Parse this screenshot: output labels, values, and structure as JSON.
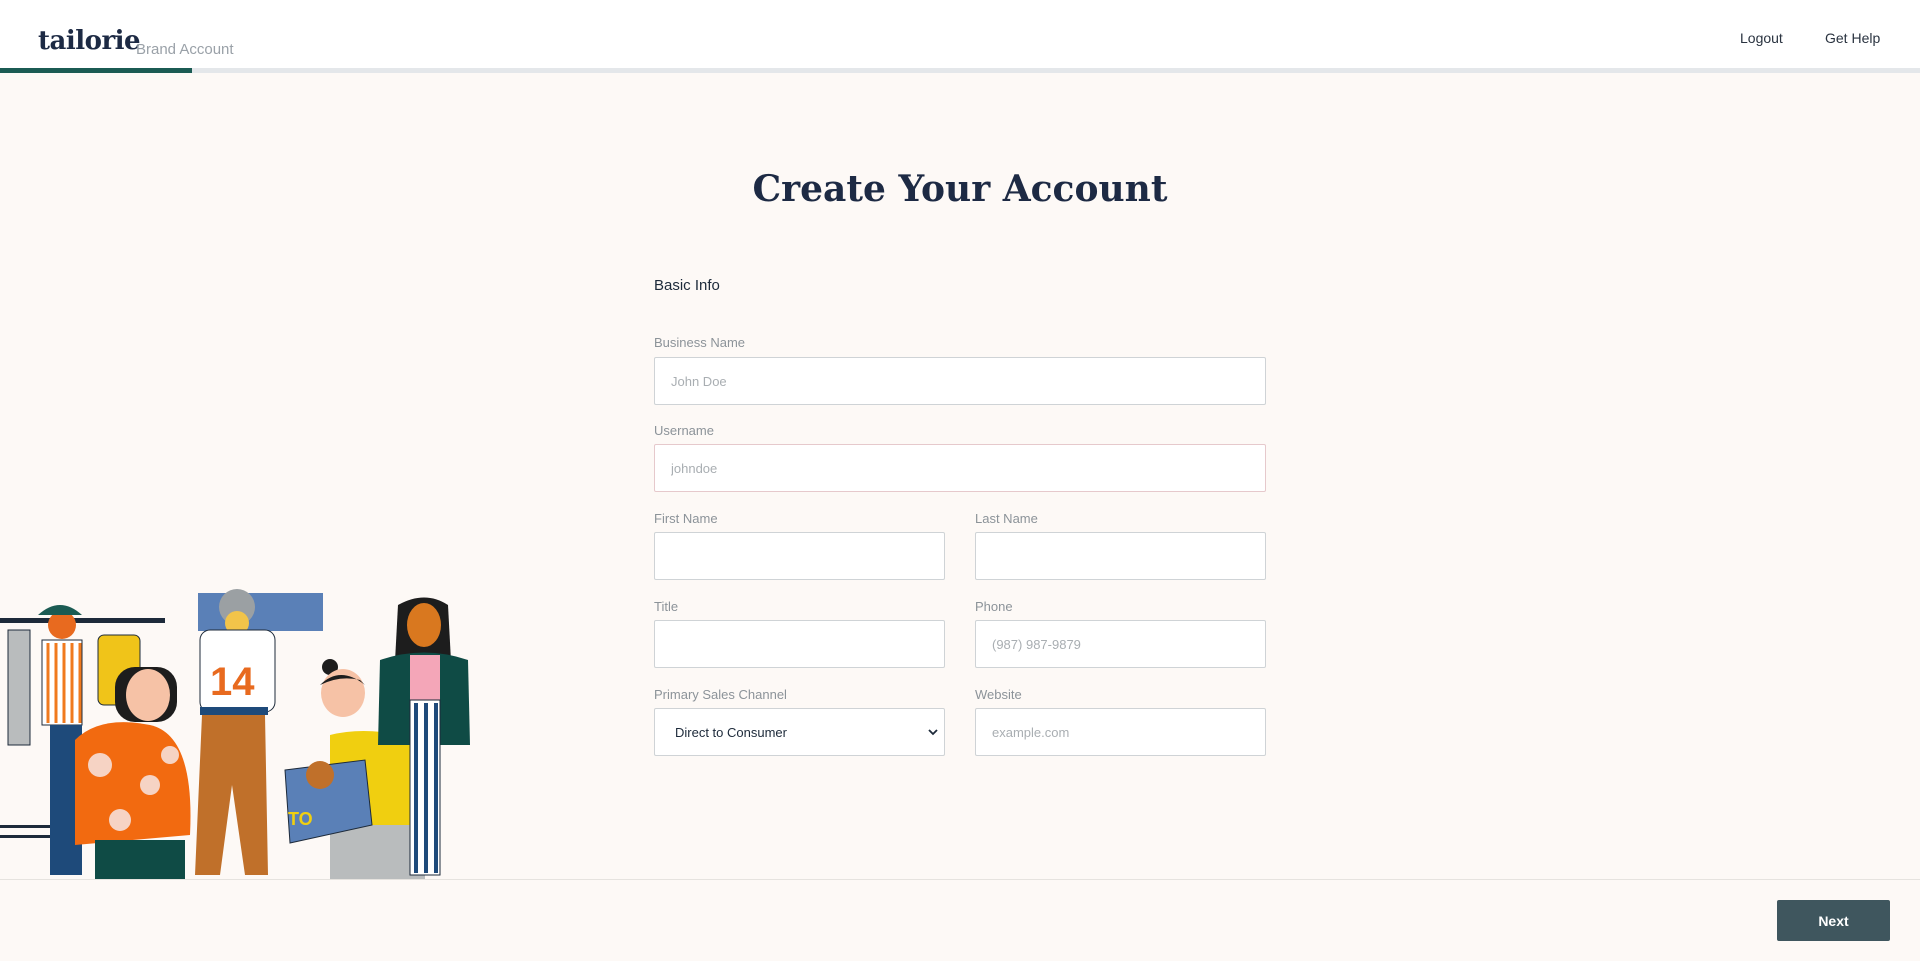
{
  "header": {
    "logo": "tailorie",
    "subtitle": "Brand Account",
    "links": {
      "logout": "Logout",
      "help": "Get Help"
    },
    "progress": 0.1
  },
  "main": {
    "title": "Create Your Account",
    "section": "Basic Info",
    "fields": {
      "business_name": {
        "label": "Business Name",
        "placeholder": "John Doe",
        "value": ""
      },
      "username": {
        "label": "Username",
        "placeholder": "johndoe",
        "value": ""
      },
      "first_name": {
        "label": "First Name",
        "value": ""
      },
      "last_name": {
        "label": "Last Name",
        "value": ""
      },
      "title": {
        "label": "Title",
        "value": ""
      },
      "phone": {
        "label": "Phone",
        "placeholder": "(987) 987-9879",
        "value": ""
      },
      "sales_channel": {
        "label": "Primary Sales Channel",
        "value": "Direct to Consumer"
      },
      "website": {
        "label": "Website",
        "placeholder": "example.com",
        "value": ""
      }
    }
  },
  "footer": {
    "next_label": "Next"
  },
  "colors": {
    "accent": "#1b5b53",
    "button": "#3f565e",
    "background": "#fdf9f6"
  }
}
